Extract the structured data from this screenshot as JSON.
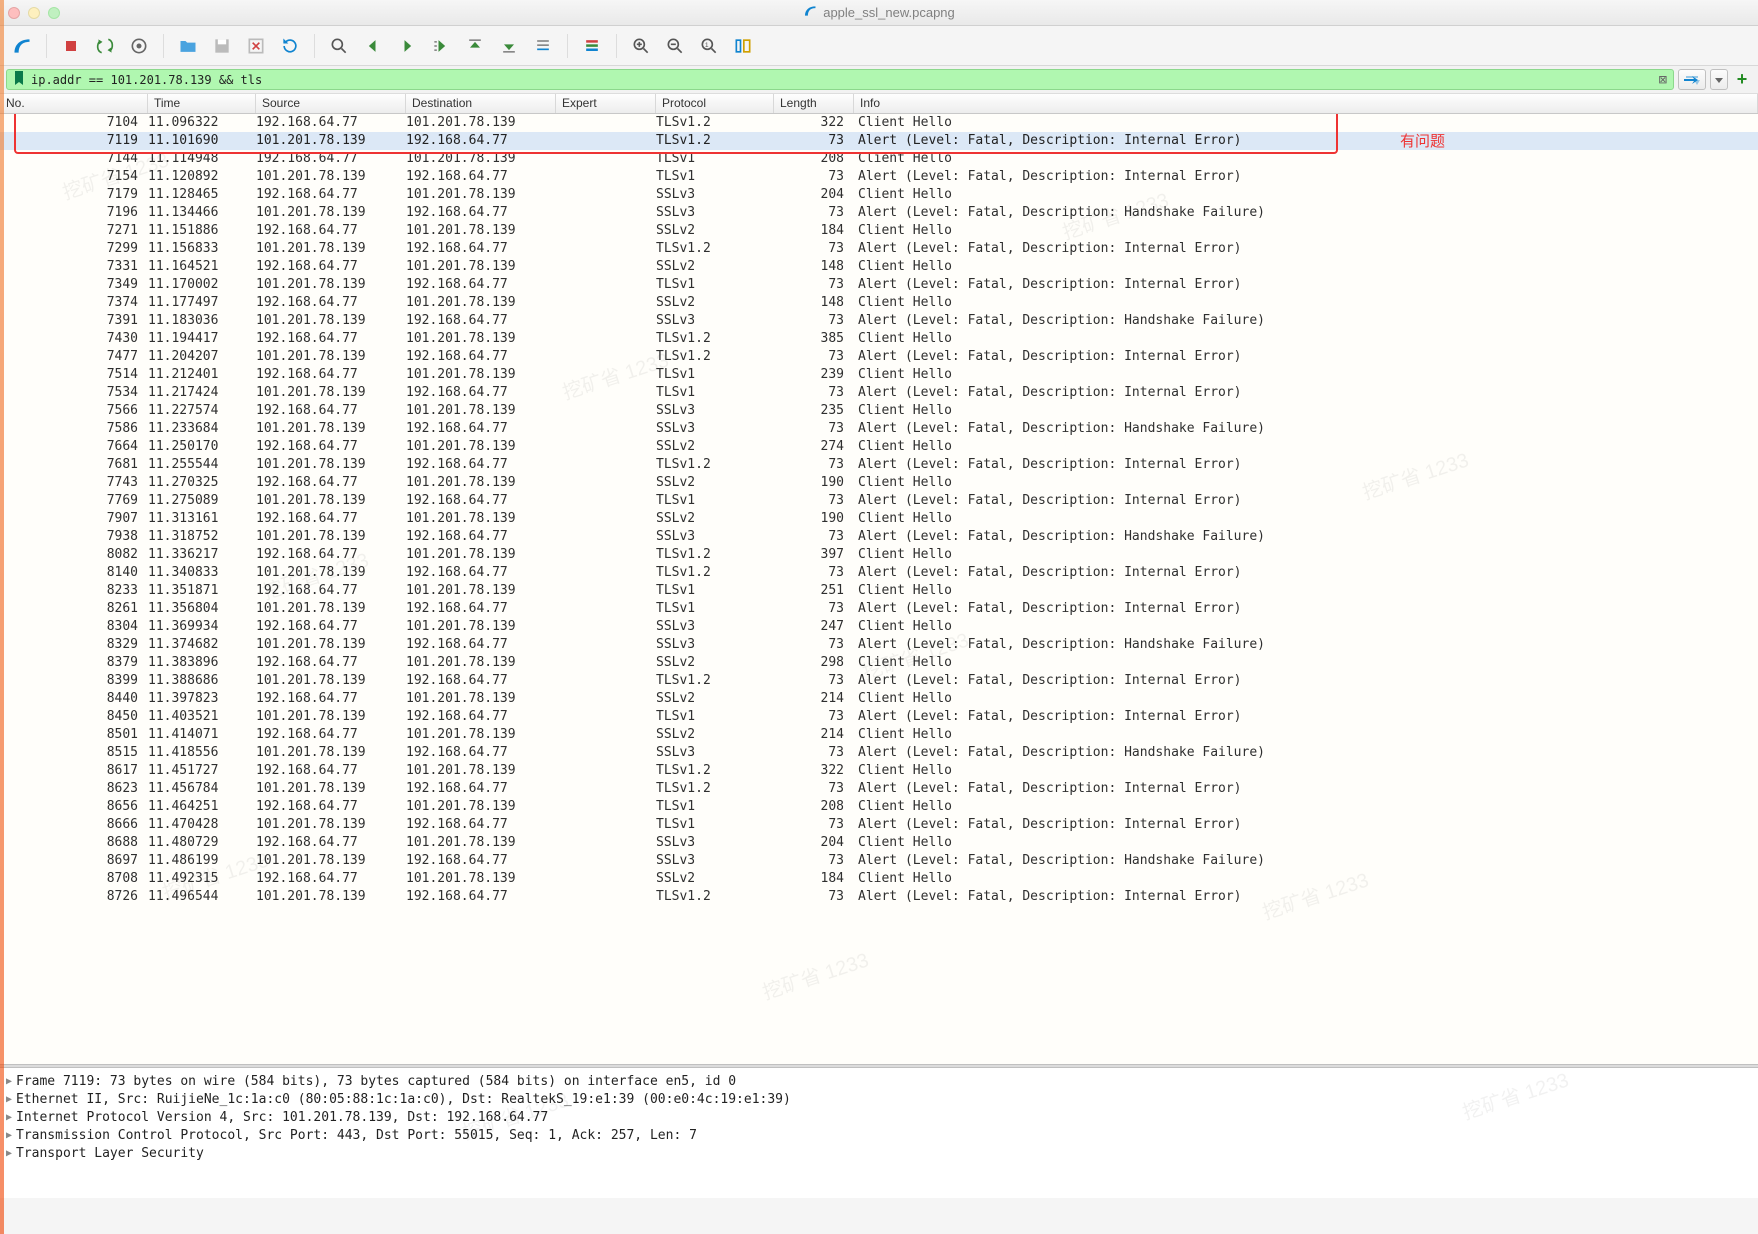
{
  "window": {
    "title": "apple_ssl_new.pcapng"
  },
  "filter": {
    "expression": "ip.addr == 101.201.78.139 && tls"
  },
  "columns": {
    "no": "No.",
    "time": "Time",
    "source": "Source",
    "destination": "Destination",
    "expert": "Expert",
    "protocol": "Protocol",
    "length": "Length",
    "info": "Info"
  },
  "annotation": "有问题",
  "selected_no": "7119",
  "packets": [
    {
      "no": "7104",
      "time": "11.096322",
      "src": "192.168.64.77",
      "dst": "101.201.78.139",
      "proto": "TLSv1.2",
      "len": "322",
      "info": "Client Hello"
    },
    {
      "no": "7119",
      "time": "11.101690",
      "src": "101.201.78.139",
      "dst": "192.168.64.77",
      "proto": "TLSv1.2",
      "len": "73",
      "info": "Alert (Level: Fatal, Description: Internal Error)"
    },
    {
      "no": "7144",
      "time": "11.114948",
      "src": "192.168.64.77",
      "dst": "101.201.78.139",
      "proto": "TLSv1",
      "len": "208",
      "info": "Client Hello"
    },
    {
      "no": "7154",
      "time": "11.120892",
      "src": "101.201.78.139",
      "dst": "192.168.64.77",
      "proto": "TLSv1",
      "len": "73",
      "info": "Alert (Level: Fatal, Description: Internal Error)"
    },
    {
      "no": "7179",
      "time": "11.128465",
      "src": "192.168.64.77",
      "dst": "101.201.78.139",
      "proto": "SSLv3",
      "len": "204",
      "info": "Client Hello"
    },
    {
      "no": "7196",
      "time": "11.134466",
      "src": "101.201.78.139",
      "dst": "192.168.64.77",
      "proto": "SSLv3",
      "len": "73",
      "info": "Alert (Level: Fatal, Description: Handshake Failure)"
    },
    {
      "no": "7271",
      "time": "11.151886",
      "src": "192.168.64.77",
      "dst": "101.201.78.139",
      "proto": "SSLv2",
      "len": "184",
      "info": "Client Hello"
    },
    {
      "no": "7299",
      "time": "11.156833",
      "src": "101.201.78.139",
      "dst": "192.168.64.77",
      "proto": "TLSv1.2",
      "len": "73",
      "info": "Alert (Level: Fatal, Description: Internal Error)"
    },
    {
      "no": "7331",
      "time": "11.164521",
      "src": "192.168.64.77",
      "dst": "101.201.78.139",
      "proto": "SSLv2",
      "len": "148",
      "info": "Client Hello"
    },
    {
      "no": "7349",
      "time": "11.170002",
      "src": "101.201.78.139",
      "dst": "192.168.64.77",
      "proto": "TLSv1",
      "len": "73",
      "info": "Alert (Level: Fatal, Description: Internal Error)"
    },
    {
      "no": "7374",
      "time": "11.177497",
      "src": "192.168.64.77",
      "dst": "101.201.78.139",
      "proto": "SSLv2",
      "len": "148",
      "info": "Client Hello"
    },
    {
      "no": "7391",
      "time": "11.183036",
      "src": "101.201.78.139",
      "dst": "192.168.64.77",
      "proto": "SSLv3",
      "len": "73",
      "info": "Alert (Level: Fatal, Description: Handshake Failure)"
    },
    {
      "no": "7430",
      "time": "11.194417",
      "src": "192.168.64.77",
      "dst": "101.201.78.139",
      "proto": "TLSv1.2",
      "len": "385",
      "info": "Client Hello"
    },
    {
      "no": "7477",
      "time": "11.204207",
      "src": "101.201.78.139",
      "dst": "192.168.64.77",
      "proto": "TLSv1.2",
      "len": "73",
      "info": "Alert (Level: Fatal, Description: Internal Error)"
    },
    {
      "no": "7514",
      "time": "11.212401",
      "src": "192.168.64.77",
      "dst": "101.201.78.139",
      "proto": "TLSv1",
      "len": "239",
      "info": "Client Hello"
    },
    {
      "no": "7534",
      "time": "11.217424",
      "src": "101.201.78.139",
      "dst": "192.168.64.77",
      "proto": "TLSv1",
      "len": "73",
      "info": "Alert (Level: Fatal, Description: Internal Error)"
    },
    {
      "no": "7566",
      "time": "11.227574",
      "src": "192.168.64.77",
      "dst": "101.201.78.139",
      "proto": "SSLv3",
      "len": "235",
      "info": "Client Hello"
    },
    {
      "no": "7586",
      "time": "11.233684",
      "src": "101.201.78.139",
      "dst": "192.168.64.77",
      "proto": "SSLv3",
      "len": "73",
      "info": "Alert (Level: Fatal, Description: Handshake Failure)"
    },
    {
      "no": "7664",
      "time": "11.250170",
      "src": "192.168.64.77",
      "dst": "101.201.78.139",
      "proto": "SSLv2",
      "len": "274",
      "info": "Client Hello"
    },
    {
      "no": "7681",
      "time": "11.255544",
      "src": "101.201.78.139",
      "dst": "192.168.64.77",
      "proto": "TLSv1.2",
      "len": "73",
      "info": "Alert (Level: Fatal, Description: Internal Error)"
    },
    {
      "no": "7743",
      "time": "11.270325",
      "src": "192.168.64.77",
      "dst": "101.201.78.139",
      "proto": "SSLv2",
      "len": "190",
      "info": "Client Hello"
    },
    {
      "no": "7769",
      "time": "11.275089",
      "src": "101.201.78.139",
      "dst": "192.168.64.77",
      "proto": "TLSv1",
      "len": "73",
      "info": "Alert (Level: Fatal, Description: Internal Error)"
    },
    {
      "no": "7907",
      "time": "11.313161",
      "src": "192.168.64.77",
      "dst": "101.201.78.139",
      "proto": "SSLv2",
      "len": "190",
      "info": "Client Hello"
    },
    {
      "no": "7938",
      "time": "11.318752",
      "src": "101.201.78.139",
      "dst": "192.168.64.77",
      "proto": "SSLv3",
      "len": "73",
      "info": "Alert (Level: Fatal, Description: Handshake Failure)"
    },
    {
      "no": "8082",
      "time": "11.336217",
      "src": "192.168.64.77",
      "dst": "101.201.78.139",
      "proto": "TLSv1.2",
      "len": "397",
      "info": "Client Hello"
    },
    {
      "no": "8140",
      "time": "11.340833",
      "src": "101.201.78.139",
      "dst": "192.168.64.77",
      "proto": "TLSv1.2",
      "len": "73",
      "info": "Alert (Level: Fatal, Description: Internal Error)"
    },
    {
      "no": "8233",
      "time": "11.351871",
      "src": "192.168.64.77",
      "dst": "101.201.78.139",
      "proto": "TLSv1",
      "len": "251",
      "info": "Client Hello"
    },
    {
      "no": "8261",
      "time": "11.356804",
      "src": "101.201.78.139",
      "dst": "192.168.64.77",
      "proto": "TLSv1",
      "len": "73",
      "info": "Alert (Level: Fatal, Description: Internal Error)"
    },
    {
      "no": "8304",
      "time": "11.369934",
      "src": "192.168.64.77",
      "dst": "101.201.78.139",
      "proto": "SSLv3",
      "len": "247",
      "info": "Client Hello"
    },
    {
      "no": "8329",
      "time": "11.374682",
      "src": "101.201.78.139",
      "dst": "192.168.64.77",
      "proto": "SSLv3",
      "len": "73",
      "info": "Alert (Level: Fatal, Description: Handshake Failure)"
    },
    {
      "no": "8379",
      "time": "11.383896",
      "src": "192.168.64.77",
      "dst": "101.201.78.139",
      "proto": "SSLv2",
      "len": "298",
      "info": "Client Hello"
    },
    {
      "no": "8399",
      "time": "11.388686",
      "src": "101.201.78.139",
      "dst": "192.168.64.77",
      "proto": "TLSv1.2",
      "len": "73",
      "info": "Alert (Level: Fatal, Description: Internal Error)"
    },
    {
      "no": "8440",
      "time": "11.397823",
      "src": "192.168.64.77",
      "dst": "101.201.78.139",
      "proto": "SSLv2",
      "len": "214",
      "info": "Client Hello"
    },
    {
      "no": "8450",
      "time": "11.403521",
      "src": "101.201.78.139",
      "dst": "192.168.64.77",
      "proto": "TLSv1",
      "len": "73",
      "info": "Alert (Level: Fatal, Description: Internal Error)"
    },
    {
      "no": "8501",
      "time": "11.414071",
      "src": "192.168.64.77",
      "dst": "101.201.78.139",
      "proto": "SSLv2",
      "len": "214",
      "info": "Client Hello"
    },
    {
      "no": "8515",
      "time": "11.418556",
      "src": "101.201.78.139",
      "dst": "192.168.64.77",
      "proto": "SSLv3",
      "len": "73",
      "info": "Alert (Level: Fatal, Description: Handshake Failure)"
    },
    {
      "no": "8617",
      "time": "11.451727",
      "src": "192.168.64.77",
      "dst": "101.201.78.139",
      "proto": "TLSv1.2",
      "len": "322",
      "info": "Client Hello"
    },
    {
      "no": "8623",
      "time": "11.456784",
      "src": "101.201.78.139",
      "dst": "192.168.64.77",
      "proto": "TLSv1.2",
      "len": "73",
      "info": "Alert (Level: Fatal, Description: Internal Error)"
    },
    {
      "no": "8656",
      "time": "11.464251",
      "src": "192.168.64.77",
      "dst": "101.201.78.139",
      "proto": "TLSv1",
      "len": "208",
      "info": "Client Hello"
    },
    {
      "no": "8666",
      "time": "11.470428",
      "src": "101.201.78.139",
      "dst": "192.168.64.77",
      "proto": "TLSv1",
      "len": "73",
      "info": "Alert (Level: Fatal, Description: Internal Error)"
    },
    {
      "no": "8688",
      "time": "11.480729",
      "src": "192.168.64.77",
      "dst": "101.201.78.139",
      "proto": "SSLv3",
      "len": "204",
      "info": "Client Hello"
    },
    {
      "no": "8697",
      "time": "11.486199",
      "src": "101.201.78.139",
      "dst": "192.168.64.77",
      "proto": "SSLv3",
      "len": "73",
      "info": "Alert (Level: Fatal, Description: Handshake Failure)"
    },
    {
      "no": "8708",
      "time": "11.492315",
      "src": "192.168.64.77",
      "dst": "101.201.78.139",
      "proto": "SSLv2",
      "len": "184",
      "info": "Client Hello"
    },
    {
      "no": "8726",
      "time": "11.496544",
      "src": "101.201.78.139",
      "dst": "192.168.64.77",
      "proto": "TLSv1.2",
      "len": "73",
      "info": "Alert (Level: Fatal, Description: Internal Error)"
    }
  ],
  "details": {
    "l0": "Frame 7119: 73 bytes on wire (584 bits), 73 bytes captured (584 bits) on interface en5, id 0",
    "l1": "Ethernet II, Src: RuijieNe_1c:1a:c0 (80:05:88:1c:1a:c0), Dst: RealtekS_19:e1:39 (00:e0:4c:19:e1:39)",
    "l2": "Internet Protocol Version 4, Src: 101.201.78.139, Dst: 192.168.64.77",
    "l3": "Transmission Control Protocol, Src Port: 443, Dst Port: 55015, Seq: 1, Ack: 257, Len: 7",
    "l4": "Transport Layer Security"
  },
  "watermark": "挖矿省 1233"
}
